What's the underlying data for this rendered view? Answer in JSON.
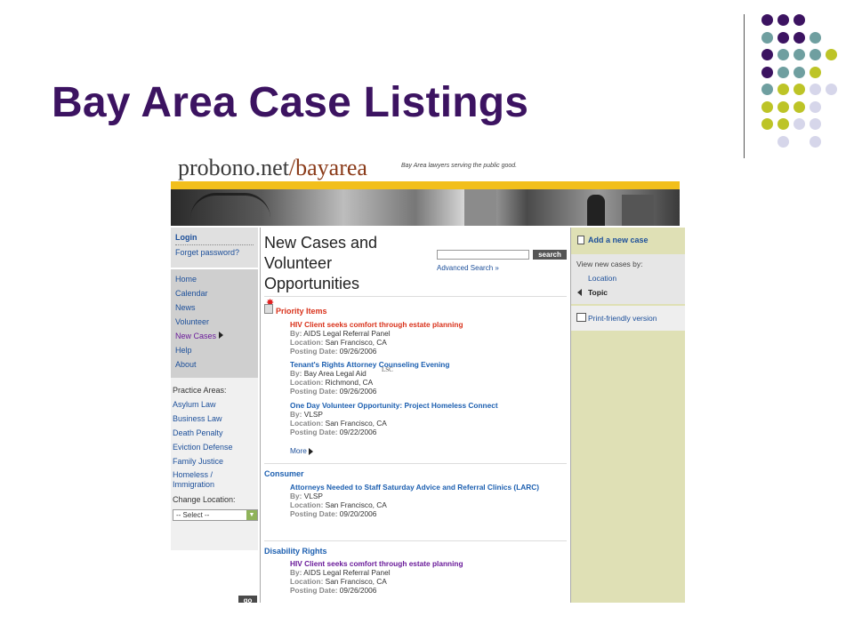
{
  "slide": {
    "title": "Bay Area Case Listings",
    "dot_colors": [
      "#3c1361",
      "#6f9fa0",
      "#bdc427",
      "#d6d6ea"
    ]
  },
  "site": {
    "logo_main": "probono.net",
    "logo_path": "/bayarea",
    "tagline": "Bay Area lawyers serving the public good."
  },
  "left_nav": {
    "login": "Login",
    "forgot": "Forget password?",
    "items": [
      {
        "label": "Home"
      },
      {
        "label": "Calendar"
      },
      {
        "label": "News"
      },
      {
        "label": "Volunteer"
      },
      {
        "label": "New Cases"
      },
      {
        "label": "Help"
      },
      {
        "label": "About"
      }
    ],
    "practice_label": "Practice Areas:",
    "practice_areas": [
      "Asylum Law",
      "Business Law",
      "Death Penalty",
      "Eviction Defense",
      "Family Justice",
      "Homeless / Immigration"
    ],
    "change_location_label": "Change Location:",
    "select_value": "-- Select --",
    "go_label": "go"
  },
  "main": {
    "heading": "New Cases and Volunteer Opportunities",
    "search_button": "search",
    "advanced_search": "Advanced Search »",
    "priority_title": "Priority Items",
    "by_label": "By:",
    "location_label": "Location:",
    "posting_label": "Posting Date:",
    "lsc": "LSC",
    "more": "More",
    "priority_listings": [
      {
        "title": "HIV Client seeks comfort through estate planning",
        "by": "AIDS Legal Referral Panel",
        "location": "San Francisco, CA",
        "date": "09/26/2006"
      },
      {
        "title": "Tenant's Rights Attorney Counseling Evening",
        "by": "Bay Area Legal Aid",
        "location": "Richmond, CA",
        "date": "09/26/2006"
      },
      {
        "title": "One Day Volunteer Opportunity: Project Homeless Connect",
        "by": "VLSP",
        "location": "San Francisco, CA",
        "date": "09/22/2006"
      }
    ],
    "consumer_title": "Consumer",
    "consumer_listing": {
      "title": "Attorneys Needed to Staff Saturday Advice and Referral Clinics (LARC)",
      "by": "VLSP",
      "location": "San Francisco, CA",
      "date": "09/20/2006"
    },
    "disability_title": "Disability Rights",
    "disability_listing": {
      "title": "HIV Client seeks comfort through estate planning",
      "by": "AIDS Legal Referral Panel",
      "location": "San Francisco, CA",
      "date": "09/26/2006"
    }
  },
  "right_col": {
    "add_case": "Add a new case",
    "view_by_label": "View new cases by:",
    "location": "Location",
    "topic": "Topic",
    "print": "Print-friendly version"
  }
}
